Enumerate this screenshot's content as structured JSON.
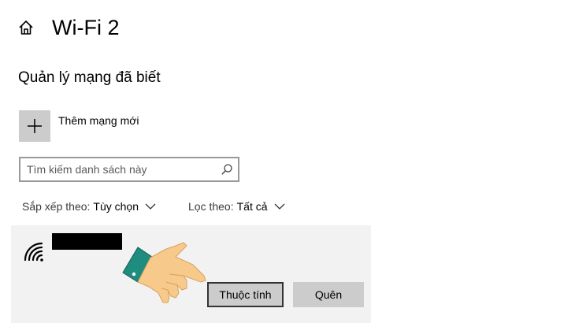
{
  "header": {
    "title": "Wi-Fi 2",
    "home_icon": "home-icon"
  },
  "section": {
    "heading": "Quản lý mạng đã biết"
  },
  "add_network": {
    "label": "Thêm mạng mới",
    "icon": "plus-icon"
  },
  "search": {
    "placeholder": "Tìm kiếm danh sách này",
    "value": "",
    "icon": "search-icon"
  },
  "sort": {
    "label": "Sắp xếp theo:",
    "value": "Tùy chọn"
  },
  "filter": {
    "label": "Lọc theo:",
    "value": "Tất cả"
  },
  "networks": [
    {
      "name_redacted": true,
      "icon": "wifi-signal-icon",
      "buttons": {
        "properties": "Thuộc tính",
        "forget": "Quên"
      }
    }
  ],
  "overlay": {
    "icon": "pointing-hand-icon"
  },
  "colors": {
    "background": "#ffffff",
    "tile": "#cccccc",
    "item_background": "#f2f2f2",
    "button": "#cccccc",
    "button_focus_border": "#333333",
    "hand_skin": "#f7c98b",
    "hand_cuff": "#1e8c7e"
  }
}
